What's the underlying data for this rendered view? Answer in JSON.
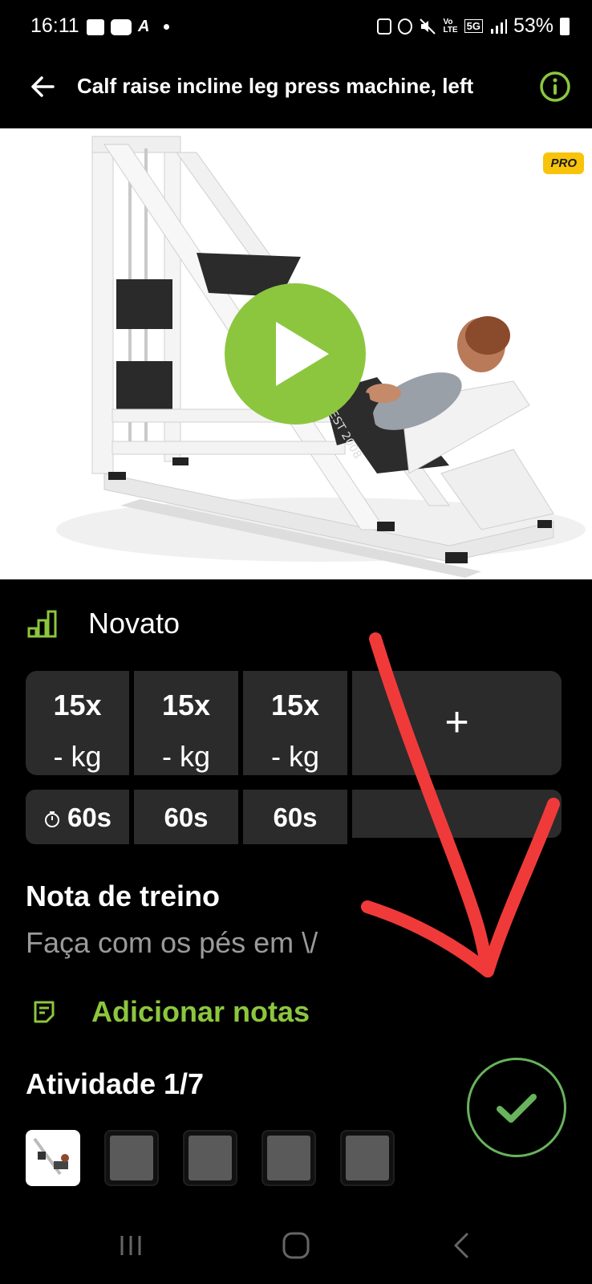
{
  "status_bar": {
    "time": "16:11",
    "network_top": "Vo",
    "network_bottom": "LTE",
    "network_5g": "5G",
    "battery": "53%"
  },
  "header": {
    "title": "Calf raise incline leg press machine, left",
    "back_icon": "arrow-left-icon",
    "info_icon": "info-icon"
  },
  "media": {
    "badge": "PRO",
    "play_icon": "play-icon",
    "jersey_text": "EST 2008"
  },
  "level": {
    "label": "Novato",
    "icon": "level-bars-icon"
  },
  "sets": [
    {
      "reps": "15x",
      "weight": "- kg",
      "rest": "60s",
      "show_timer_icon": true
    },
    {
      "reps": "15x",
      "weight": "- kg",
      "rest": "60s",
      "show_timer_icon": false
    },
    {
      "reps": "15x",
      "weight": "- kg",
      "rest": "60s",
      "show_timer_icon": false
    }
  ],
  "add_set_label": "+",
  "notes": {
    "title": "Nota de treino",
    "text": "Faça com os pés em \\/",
    "add_label": "Adicionar notas"
  },
  "activity": {
    "title": "Atividade 1/7",
    "current": 1,
    "total": 7,
    "visible_thumbnails": 5
  },
  "colors": {
    "accent_green": "#8cc63e",
    "check_green": "#68b35c",
    "cell_bg": "#2b2b2b",
    "note_gray": "#9a9a9a",
    "pro_yellow": "#f8c30b",
    "annotation_red": "#f03a3a"
  }
}
